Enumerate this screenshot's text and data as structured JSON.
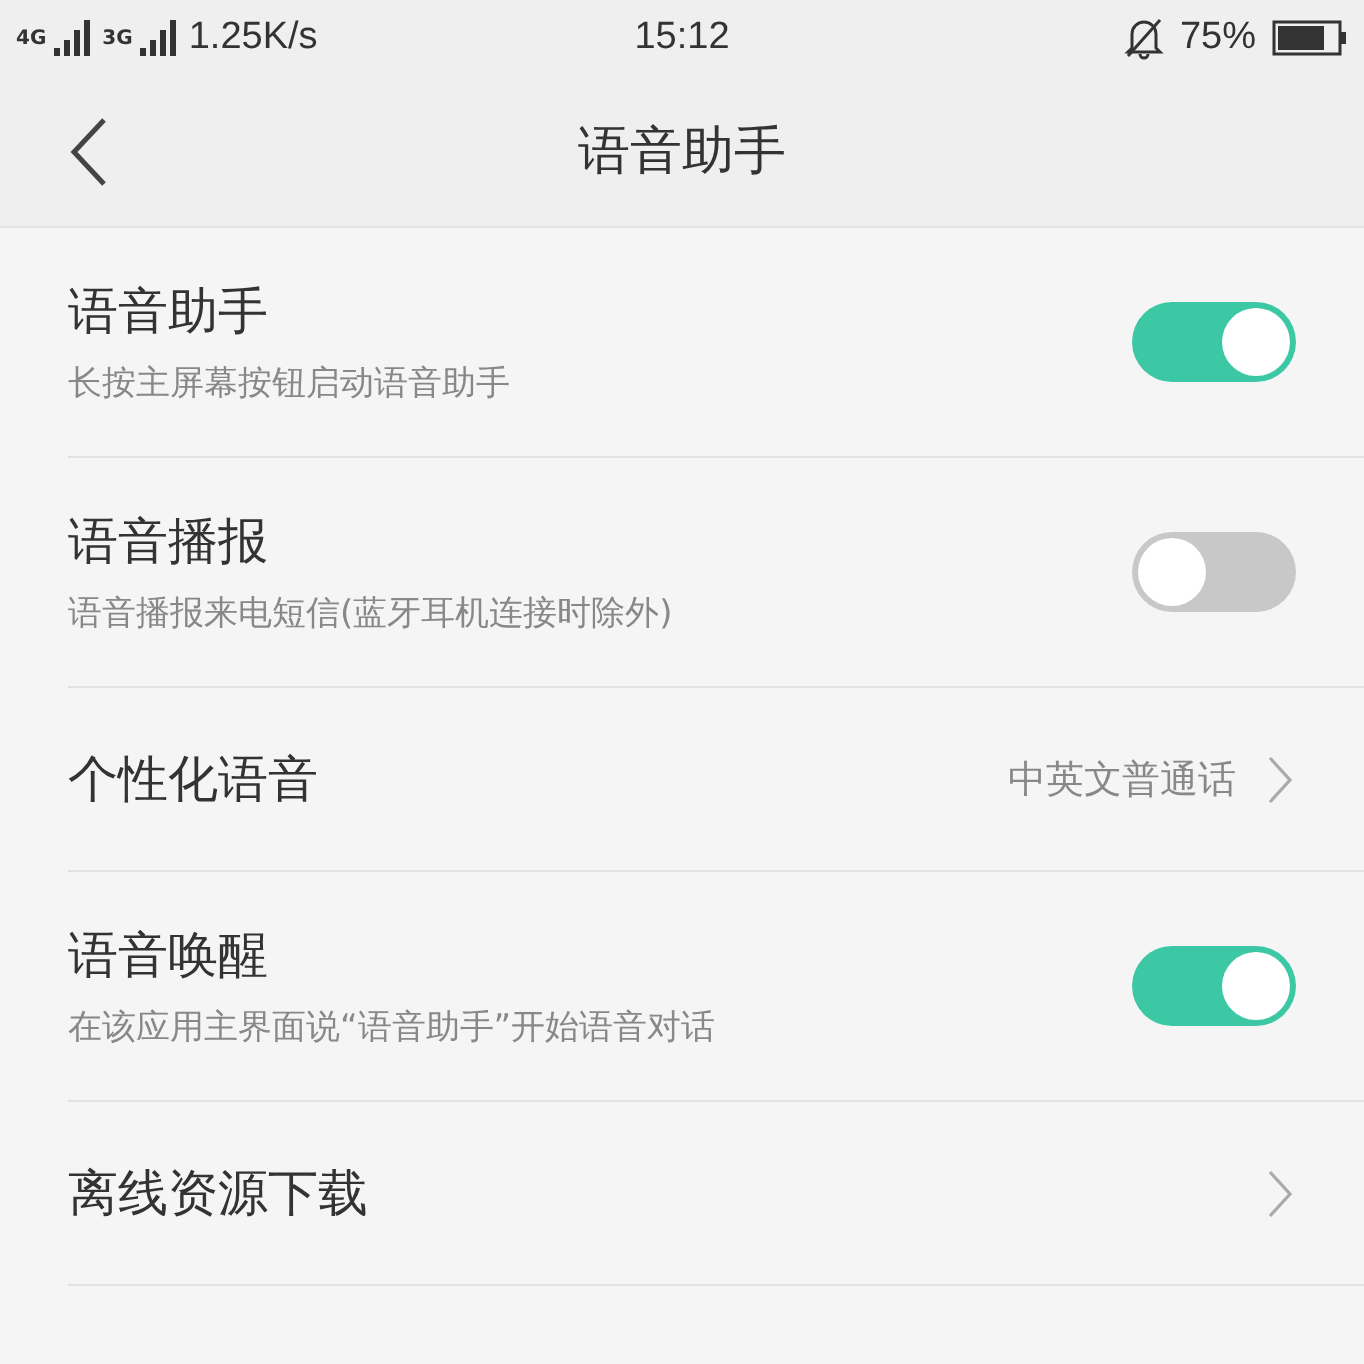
{
  "status_bar": {
    "network_left": "4G",
    "network_right": "3G",
    "speed": "1.25K/s",
    "time": "15:12",
    "battery": "75%"
  },
  "header": {
    "title": "语音助手"
  },
  "items": [
    {
      "kind": "toggle",
      "title": "语音助手",
      "subtitle": "长按主屏幕按钮启动语音助手",
      "on": true
    },
    {
      "kind": "toggle",
      "title": "语音播报",
      "subtitle": "语音播报来电短信(蓝牙耳机连接时除外)",
      "on": false
    },
    {
      "kind": "link",
      "title": "个性化语音",
      "value": "中英文普通话"
    },
    {
      "kind": "toggle",
      "title": "语音唤醒",
      "subtitle": "在该应用主界面说“语音助手”开始语音对话",
      "on": true
    },
    {
      "kind": "link",
      "title": "离线资源下载"
    }
  ]
}
